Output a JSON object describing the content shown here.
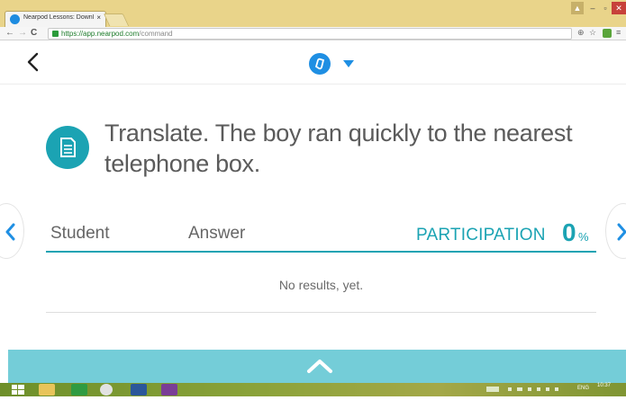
{
  "browser": {
    "tab_title": "Nearpod Lessons: Downl",
    "tab_close": "×",
    "url_host": "https://app.nearpod.com",
    "url_path": "/command",
    "controls": {
      "back": "←",
      "forward": "→",
      "reload": "C",
      "zoom": "⊕",
      "star": "☆",
      "menu": "≡",
      "minimize": "–",
      "maximize": "▫",
      "close": "✕",
      "user": "▲"
    }
  },
  "header": {
    "logo": "nearpod-logo-icon",
    "accent": "#1f8fe3"
  },
  "question": {
    "text": "Translate. The boy ran quickly to the nearest telephone box."
  },
  "results": {
    "col_student": "Student",
    "col_answer": "Answer",
    "participation_label": "PARTICIPATION",
    "participation_value": "0",
    "participation_unit": "%",
    "empty_message": "No results, yet."
  },
  "taskbar": {
    "lang": "ENG",
    "time": "10:37"
  },
  "colors": {
    "teal": "#1ba3b3",
    "drawer": "#74cdd8",
    "chrome_frame": "#e9d48a"
  }
}
